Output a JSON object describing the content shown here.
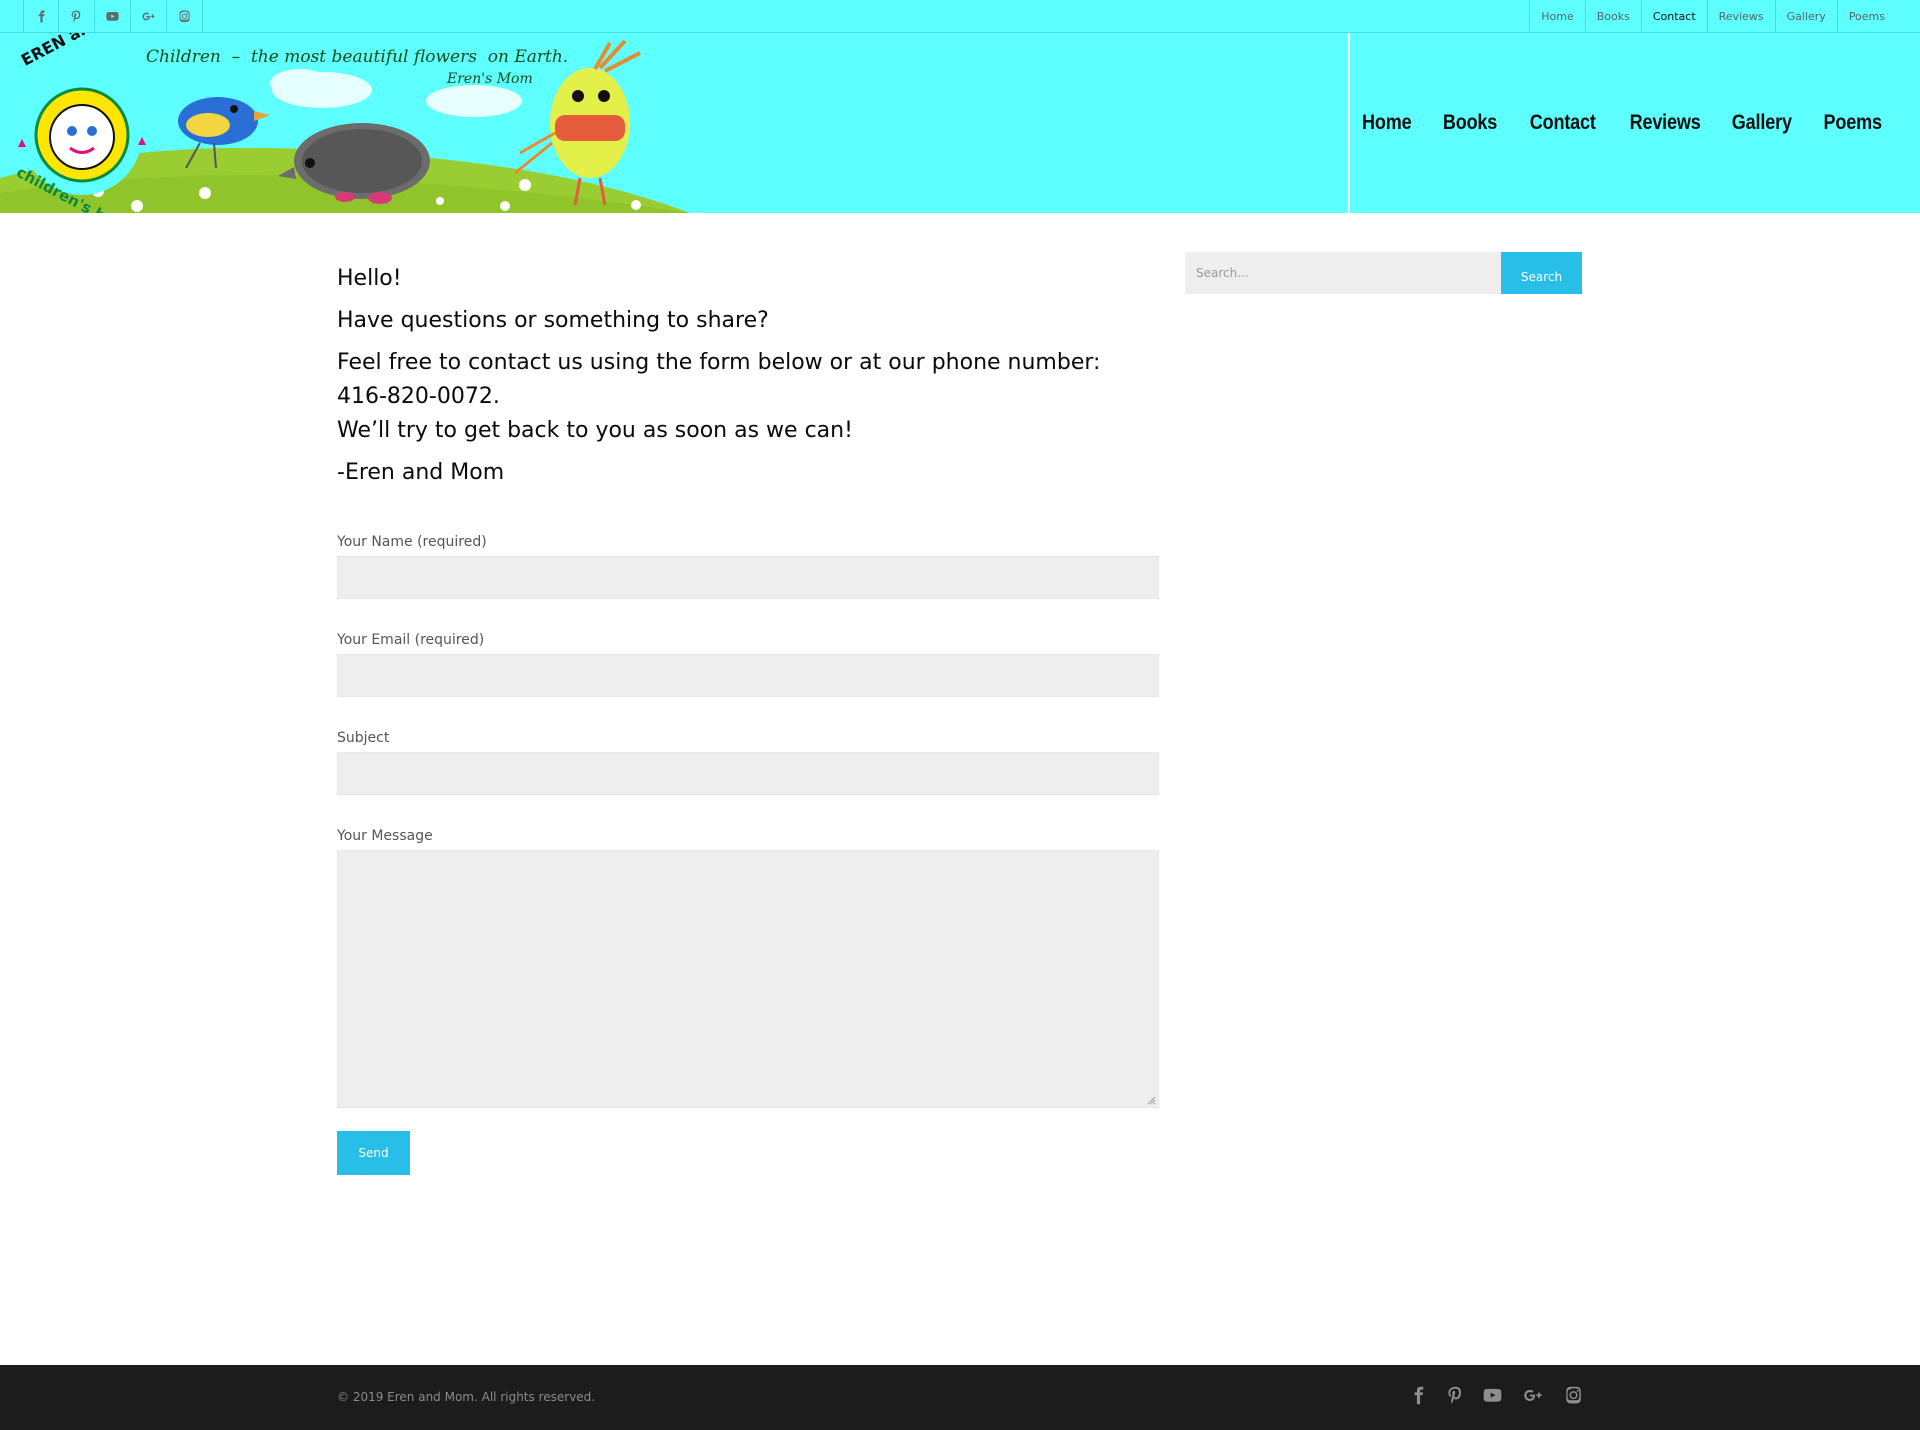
{
  "topbar": {
    "social": [
      "facebook-icon",
      "pinterest-icon",
      "youtube-icon",
      "google-plus-icon",
      "instagram-icon"
    ],
    "nav": [
      {
        "label": "Home"
      },
      {
        "label": "Books"
      },
      {
        "label": "Contact",
        "active": true
      },
      {
        "label": "Reviews"
      },
      {
        "label": "Gallery"
      },
      {
        "label": "Poems"
      }
    ]
  },
  "header": {
    "logo_top_text": "EREN and MOM",
    "logo_bottom_text": "children's books",
    "tagline": "Children  –  the most beautiful flowers  on Earth.",
    "tagline_author": "Eren's Mom",
    "nav": [
      "Home",
      "Books",
      "Contact",
      "Reviews",
      "Gallery",
      "Poems"
    ]
  },
  "intro": {
    "line1": "Hello!",
    "line2": "Have questions or something to share?",
    "line3": "Feel free to contact us using the form below or at our phone number:",
    "line4": "416-820-0072.",
    "line5": "We’ll try to get back to you as soon as we can!",
    "line6": "-Eren and Mom"
  },
  "form": {
    "name_label": "Your Name (required)",
    "email_label": "Your Email (required)",
    "subject_label": "Subject",
    "message_label": "Your Message",
    "send_label": "Send"
  },
  "sidebar": {
    "search_placeholder": "Search...",
    "search_button": "Search"
  },
  "footer": {
    "copyright": "© 2019 Eren and Mom. All rights reserved.",
    "social": [
      "facebook-icon",
      "pinterest-icon",
      "youtube-icon",
      "google-plus-icon",
      "instagram-icon"
    ]
  },
  "colors": {
    "header_bg": "#5dffff",
    "accent": "#27bfe8",
    "footer_bg": "#1c1c1c",
    "field_bg": "#eeeeee"
  }
}
